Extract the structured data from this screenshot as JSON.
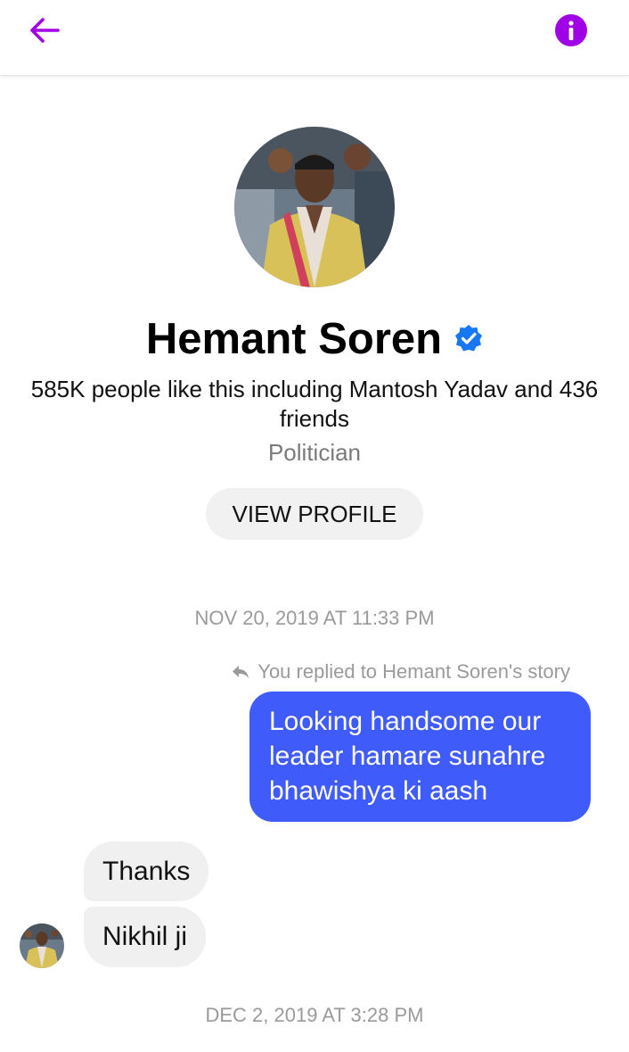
{
  "header": {
    "back_icon": "arrow-left-icon",
    "info_icon": "info-icon",
    "accent_color": "#a000e6"
  },
  "profile": {
    "name": "Hemant Soren",
    "verified_icon": "verified-badge-icon",
    "likes_text": "585K people like this including Mantosh Yadav and 436 friends",
    "category": "Politician",
    "view_profile_label": "VIEW PROFILE"
  },
  "conversation": {
    "timestamp_1": "NOV 20, 2019 AT 11:33 PM",
    "reply_note": "You replied to Hemant Soren's story",
    "reply_icon": "reply-arrow-icon",
    "outgoing_message": "Looking handsome our leader hamare sunahre bhawishya ki aash",
    "incoming_messages": [
      "Thanks",
      "Nikhil ji"
    ],
    "timestamp_2": "DEC 2, 2019 AT 3:28 PM"
  },
  "colors": {
    "outgoing_bubble": "#3f5bfa",
    "incoming_bubble": "#f0f0f0",
    "verified": "#1877f2"
  }
}
